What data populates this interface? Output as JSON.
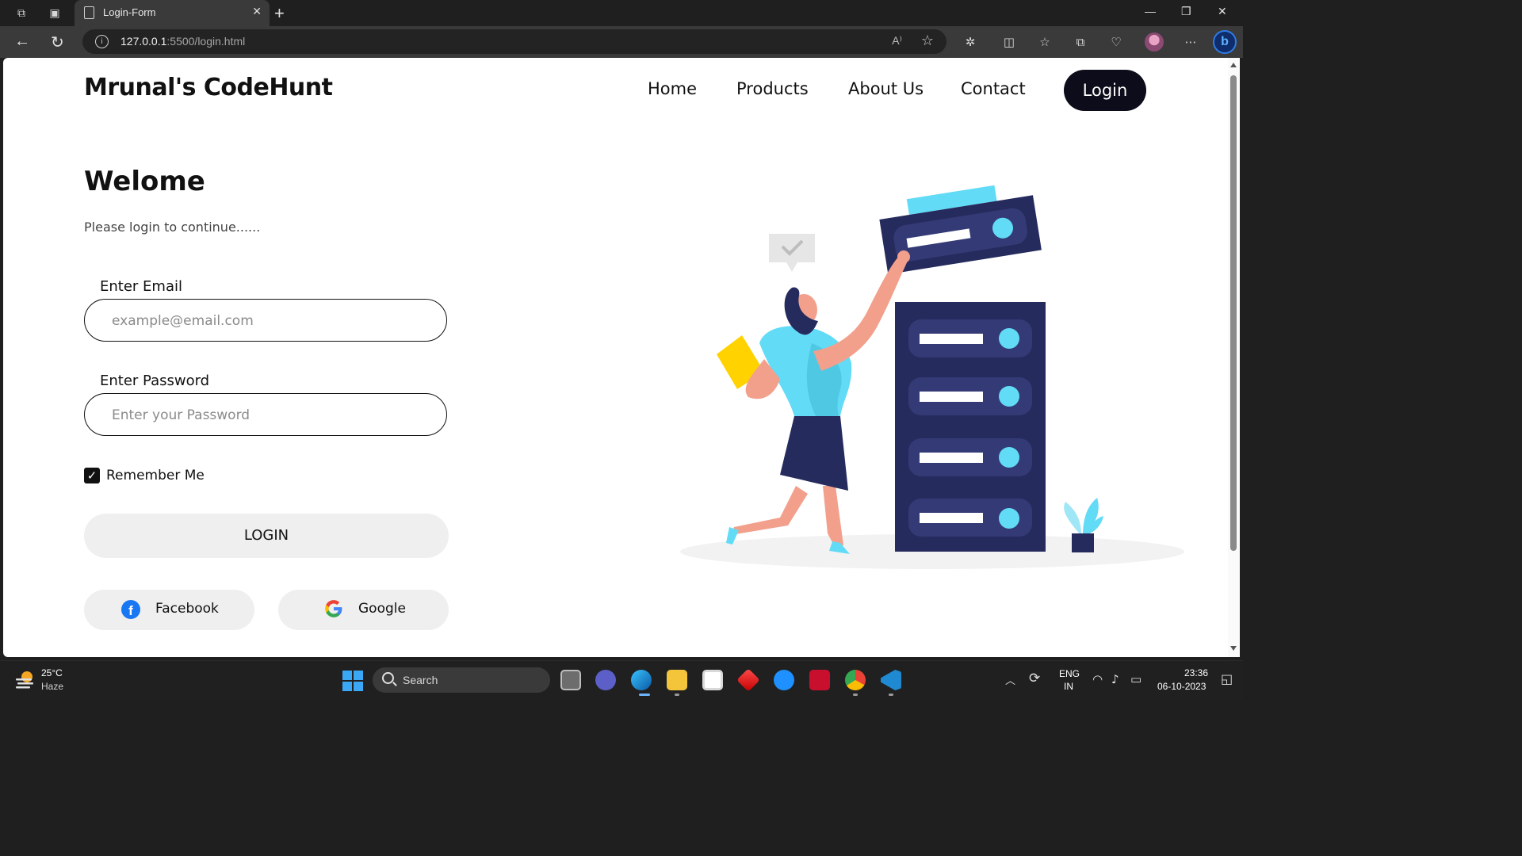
{
  "browser": {
    "tab_title": "Login-Form",
    "url_host": "127.0.0.1",
    "url_rest": ":5500/login.html",
    "read_aloud_label": "A⁾"
  },
  "page": {
    "brand": "Mrunal's CodeHunt",
    "nav": [
      "Home",
      "Products",
      "About Us",
      "Contact"
    ],
    "nav_login": "Login",
    "welcome": "Welome",
    "subtitle": "Please login to continue......",
    "email_label": "Enter Email",
    "email_placeholder": "example@email.com",
    "password_label": "Enter Password",
    "password_placeholder": "Enter your Password",
    "remember_label": "Remember Me",
    "remember_checked": true,
    "login_button": "LOGIN",
    "facebook_button": "Facebook",
    "google_button": "Google"
  },
  "taskbar": {
    "weather_temp": "25°C",
    "weather_cond": "Haze",
    "search_label": "Search",
    "lang_line1": "ENG",
    "lang_line2": "IN",
    "time": "23:36",
    "date": "06-10-2023"
  },
  "colors": {
    "primary_dark": "#0c0c1a",
    "illustration_navy": "#262b5e",
    "illustration_cyan": "#62dbf6",
    "illustration_skin": "#f2a08c",
    "illustration_yellow": "#ffd200"
  }
}
